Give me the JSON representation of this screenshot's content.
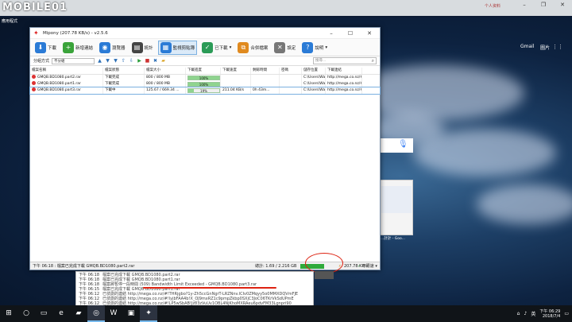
{
  "watermark": "MOBILE01",
  "chrome": {
    "user": "个人资料",
    "bookmark": "應用程式",
    "gmail": "Gmail",
    "images": "圖片",
    "tile_caption": "...計計 - Goo..."
  },
  "app": {
    "title": "Mipony (207.78 KB/s) - v2.5.6",
    "toolbar": [
      {
        "label": "下載",
        "icon": "download-icon",
        "color": "#2b7bd6"
      },
      {
        "label": "新增連結",
        "icon": "add-link-icon",
        "color": "#3aa33a"
      },
      {
        "label": "瀏覽器",
        "icon": "browser-icon",
        "color": "#2b7bd6"
      },
      {
        "label": "統計",
        "icon": "stats-icon",
        "color": "#444"
      },
      {
        "label": "監視剪貼簿",
        "icon": "clipboard-icon",
        "color": "#2b7bd6",
        "active": true
      },
      {
        "label": "已下載",
        "icon": "downloaded-icon",
        "color": "#2b9b57"
      },
      {
        "label": "合併檔案",
        "icon": "merge-icon",
        "color": "#e08a1f"
      },
      {
        "label": "設定",
        "icon": "settings-icon",
        "color": "#777"
      },
      {
        "label": "說明",
        "icon": "help-icon",
        "color": "#2b7bd6"
      }
    ],
    "filter": {
      "group_label": "分組方式",
      "group_value": "不分組",
      "search_placeholder": "搜尋..."
    },
    "table": {
      "headers": [
        "檔案名稱",
        "檔案狀態",
        "檔案大小",
        "下載進度",
        "下載速度",
        "剩餘時間",
        "密碼",
        "儲存位置",
        "下載連結"
      ],
      "rows": [
        {
          "name": "GMQB.BD1080.part2.rar",
          "status": "下載完成",
          "size": "800 / 800 MB",
          "progress": 100,
          "progress_text": "100%",
          "speed": "",
          "remaining": "",
          "password": "",
          "location": "C:\\Users\\Wan\\Dow...",
          "link": "http://mega.co.nz/#..."
        },
        {
          "name": "GMQB.BD1080.part1.rar",
          "status": "下載完成",
          "size": "800 / 800 MB",
          "progress": 100,
          "progress_text": "100%",
          "speed": "",
          "remaining": "",
          "password": "",
          "location": "C:\\Users\\Wan\\Dow...",
          "link": "http://mega.co.nz/#..."
        },
        {
          "name": "GMQB.BD1080.part3.rar",
          "status": "下載中",
          "size": "125.67 / 669.34 ...",
          "progress": 19,
          "progress_text": "19%",
          "speed": "211.04 KB/s",
          "remaining": "0h 43m...",
          "password": "",
          "location": "C:\\Users\\Wan\\Dow...",
          "link": "http://mega.co.nz/#...",
          "selected": true
        }
      ]
    },
    "status": {
      "message": "下午 06:18 : 檔案已完成下載 GMQB.BD1080.part2.rar",
      "total": "總計: 1.69 / 2.216 GB",
      "total_progress": 0.76,
      "speed": "207.78 KB/s",
      "limit": "不限速"
    }
  },
  "log": [
    {
      "time": "下午 06:18",
      "text": "檔案已完成下載 GMQB.BD1080.part2.rar"
    },
    {
      "time": "下午 06:18",
      "text": "檔案已完成下載 GMQB.BD1080.part1.rar"
    },
    {
      "time": "下午 06:18",
      "text": "檔案將暫停一段時間 (509) Bandwidth Limit Exceeded - GMQB.BD1080.part3.rar"
    },
    {
      "time": "下午 06:15",
      "text": "檔案已完成下載 GMQB.BD1080.part1.rar"
    },
    {
      "time": "下午 06:12",
      "text": "已偵測的連結 http://mega.co.nz/#!THRjgbo?1y-Zh5ccGnNgrT-LRZNnv.lCIv0ZMqyy5o0MMXDQVmFJE"
    },
    {
      "time": "下午 06:12",
      "text": "已偵測的連結 http://mega.co.nz/#!IyjbFAA4b!X_OJ9mxRZ1c9pmpZkbp0SXjC3JoC06TKrVkSdUPmE"
    },
    {
      "time": "下午 06:12",
      "text": "已偵測的連結 http://mega.co.nz/#!LP5wSbAB!Jz83zVuUv1OBL4NjKhoMXRAeu6pdvFM33Lgnpri90"
    }
  ],
  "taskbar": {
    "items": [
      "windows-start-icon",
      "search-icon",
      "task-view-icon",
      "edge-icon",
      "explorer-icon",
      "chrome-icon",
      "word-icon",
      "store-icon",
      "mipony-icon"
    ],
    "lang": "英",
    "time": "下午 06:29",
    "date": "2018/7/4"
  }
}
